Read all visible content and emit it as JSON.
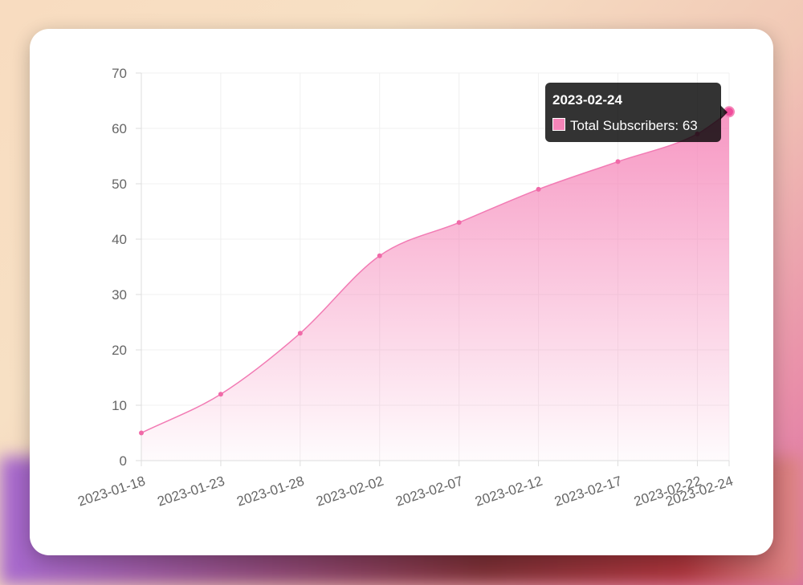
{
  "chart_data": {
    "type": "area",
    "x": [
      "2023-01-18",
      "2023-01-23",
      "2023-01-28",
      "2023-02-02",
      "2023-02-07",
      "2023-02-12",
      "2023-02-17",
      "2023-02-22",
      "2023-02-24"
    ],
    "series": [
      {
        "name": "Total Subscribers",
        "values": [
          5,
          12,
          23,
          37,
          43,
          49,
          54,
          59,
          63
        ]
      }
    ],
    "ylim": [
      0,
      70
    ],
    "yticks": [
      0,
      10,
      20,
      30,
      40,
      50,
      60,
      70
    ],
    "xticks": [
      "2023-01-18",
      "2023-01-23",
      "2023-01-28",
      "2023-02-02",
      "2023-02-07",
      "2023-02-12",
      "2023-02-17",
      "2023-02-22",
      "2023-02-24"
    ],
    "grid": true,
    "line_color": "#f27bb4",
    "fill_color": "#f585b8"
  },
  "tooltip": {
    "title": "2023-02-24",
    "label": "Total Subscribers: 63"
  }
}
